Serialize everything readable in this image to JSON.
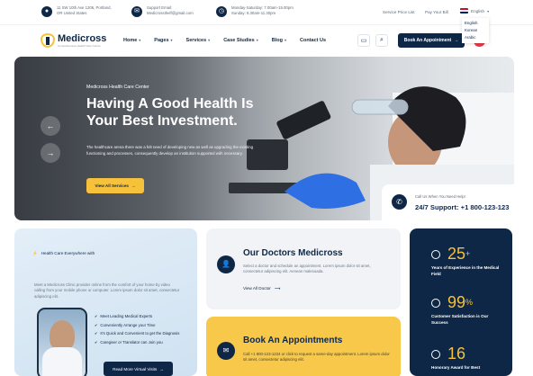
{
  "topbar": {
    "address": [
      "11 SW 10th Ave 1206, Portland,",
      "OR United States"
    ],
    "email": [
      "Support Email:",
      "Medicrossthelf@gmail.com"
    ],
    "hours": [
      "Monday-Saturday: 7.00am-15.00pm",
      "Sunday: 8.30am-11.30pm"
    ],
    "links": [
      "Service Price List",
      "Pay Your Bill"
    ],
    "language": {
      "selected": "English",
      "options": [
        "English",
        "Korean",
        "Arabic"
      ]
    }
  },
  "nav": {
    "logo_name": "Medicross",
    "logo_tagline": "Comprehensive Health Care Centre",
    "menu": [
      "Home",
      "Pages",
      "Services",
      "Case Studies",
      "Blog",
      "Contact Us"
    ],
    "appointment_label": "Book An Appointment"
  },
  "hero": {
    "kicker": "Medicross Health Care Center",
    "title": "Having A Good Health Is Your Best Investment.",
    "description": "The healthcare arena there was a felt need of developing new as well as upgrading the existing functioning and processes, consequently develop an institution supported with necessary.",
    "cta_label": "View All Services",
    "support_sub": "Call Us When You Need Help!",
    "support_main": "24/7 Support: +1 800-123-123"
  },
  "card_everywhere": {
    "tag": "Health Care Everywhere with",
    "description": "Meet a Medicross Clinic provider online from the comfort of your home by video calling from your mobile phone or computer. Lorem ipsum dolor sit amet, consectetur adipiscing elit.",
    "features": [
      "Meet Leading Medical Experts",
      "Conveniently Arrange your Time",
      "It's Quick and Convenient to get the Diagnosis",
      "Caregiver or Translator can Join you"
    ],
    "button_label": "Read More Virtual Visits"
  },
  "card_doctors": {
    "title": "Our Doctors Medicross",
    "description": "Select a doctor and schedule an appointment. Lorem ipsum dolor sit amet, consectetur adipiscing elit. Aenean malesuada.",
    "link_label": "View All Doctor"
  },
  "card_appointment": {
    "title": "Book An Appointments",
    "description": "Call +1 800-123-1234 or click to request a same-day appointment. Lorem ipsum dolor sit amet, consectetur adipiscing elit."
  },
  "stats": [
    {
      "number": "25",
      "suffix": "+",
      "label": "Years of Experience in the Medical Field"
    },
    {
      "number": "99",
      "suffix": "%",
      "label": "Customer Satisfaction is Our Success"
    },
    {
      "number": "16",
      "suffix": "",
      "label": "Honorary Award for Best"
    }
  ],
  "colors": {
    "navy": "#0f2747",
    "yellow": "#f6c13b",
    "light_blue": "#dbe9f5"
  }
}
